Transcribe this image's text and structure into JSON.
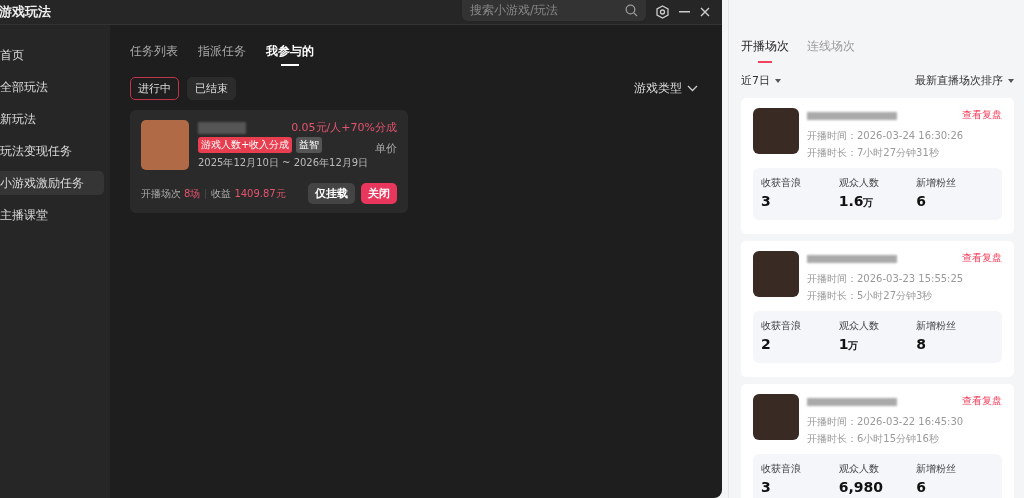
{
  "window": {
    "title": "游戏玩法",
    "search": {
      "placeholder": "搜索小游戏/玩法"
    }
  },
  "sidebar": {
    "items": [
      {
        "label": "首页",
        "selected": false
      },
      {
        "label": "全部玩法",
        "selected": false
      },
      {
        "label": "新玩法",
        "selected": false
      },
      {
        "label": "玩法变现任务",
        "selected": false
      },
      {
        "label": "小游戏激励任务",
        "selected": true
      },
      {
        "label": "主播课堂",
        "selected": false
      }
    ]
  },
  "tabs": [
    {
      "label": "任务列表",
      "selected": false
    },
    {
      "label": "指派任务",
      "selected": false
    },
    {
      "label": "我参与的",
      "selected": true
    }
  ],
  "filters": [
    {
      "label": "进行中",
      "selected": true
    },
    {
      "label": "已结束",
      "selected": false
    }
  ],
  "game_type_dropdown": {
    "label": "游戏类型"
  },
  "task_card": {
    "price": "0.05元/人+70%分成",
    "price_label": "单价",
    "tags": [
      {
        "label": "游戏人数+收入分成",
        "kind": "highlight"
      },
      {
        "label": "益智",
        "kind": "plain"
      }
    ],
    "date_range": "2025年12月10日 ~ 2026年12月9日",
    "sessions_label": "开播场次",
    "sessions": "8场",
    "income_label": "收益",
    "income": "1409.87元",
    "buttons": [
      {
        "label": "仅挂载",
        "kind": "secondary"
      },
      {
        "label": "关闭",
        "kind": "primary"
      }
    ]
  },
  "live_panel": {
    "tabs": [
      {
        "label": "开播场次",
        "selected": true
      },
      {
        "label": "连线场次",
        "selected": false
      }
    ],
    "period": "近7日",
    "sort": "最新直播场次排序",
    "sessions": [
      {
        "start": "开播时间：2026-03-24 16:30:26",
        "duration": "开播时长：7小时27分钟31秒",
        "link": "查看复盘",
        "metrics": [
          {
            "label": "收获音浪",
            "value": "3"
          },
          {
            "label": "观众人数",
            "value": "1.6",
            "unit": "万"
          },
          {
            "label": "新增粉丝",
            "value": "6"
          }
        ]
      },
      {
        "start": "开播时间：2026-03-23 15:55:25",
        "duration": "开播时长：5小时27分钟3秒",
        "link": "查看复盘",
        "metrics": [
          {
            "label": "收获音浪",
            "value": "2"
          },
          {
            "label": "观众人数",
            "value": "1",
            "unit": "万"
          },
          {
            "label": "新增粉丝",
            "value": "8"
          }
        ]
      },
      {
        "start": "开播时间：2026-03-22 16:45:30",
        "duration": "开播时长：6小时15分钟16秒",
        "link": "查看复盘",
        "metrics": [
          {
            "label": "收获音浪",
            "value": "3"
          },
          {
            "label": "观众人数",
            "value": "6,980"
          },
          {
            "label": "新增粉丝",
            "value": "6"
          }
        ]
      }
    ]
  }
}
